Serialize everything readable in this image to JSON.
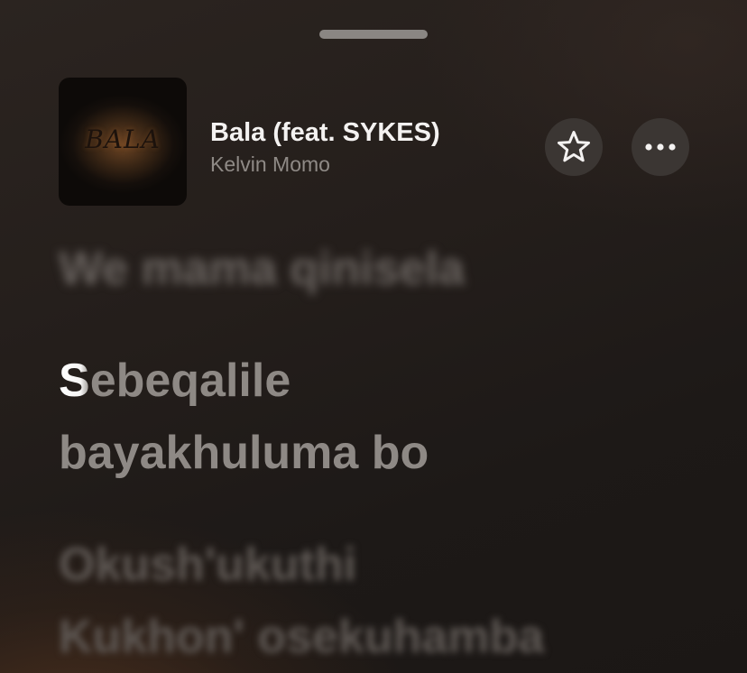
{
  "player": {
    "title": "Bala (feat. SYKES)",
    "artist": "Kelvin Momo",
    "artwork_text": "BALA"
  },
  "actions": {
    "favorite_icon": "star-outline-icon",
    "more_icon": "ellipsis-icon"
  },
  "lyrics": {
    "previous_line": "We mama qinisela",
    "current_line_sung": "S",
    "current_line_rest": "ebeqalile",
    "current_line_2": "bayakhuluma bo",
    "next_line_1": "Okush'ukuthi",
    "next_line_2": "Kukhon' osekuhamba"
  },
  "colors": {
    "background": "#231d1a",
    "title": "#f4f2f1",
    "artist": "#8f8a86",
    "button_bg": "#3b3633",
    "lyric_active": "#8e8985",
    "lyric_sung": "#ffffff"
  }
}
